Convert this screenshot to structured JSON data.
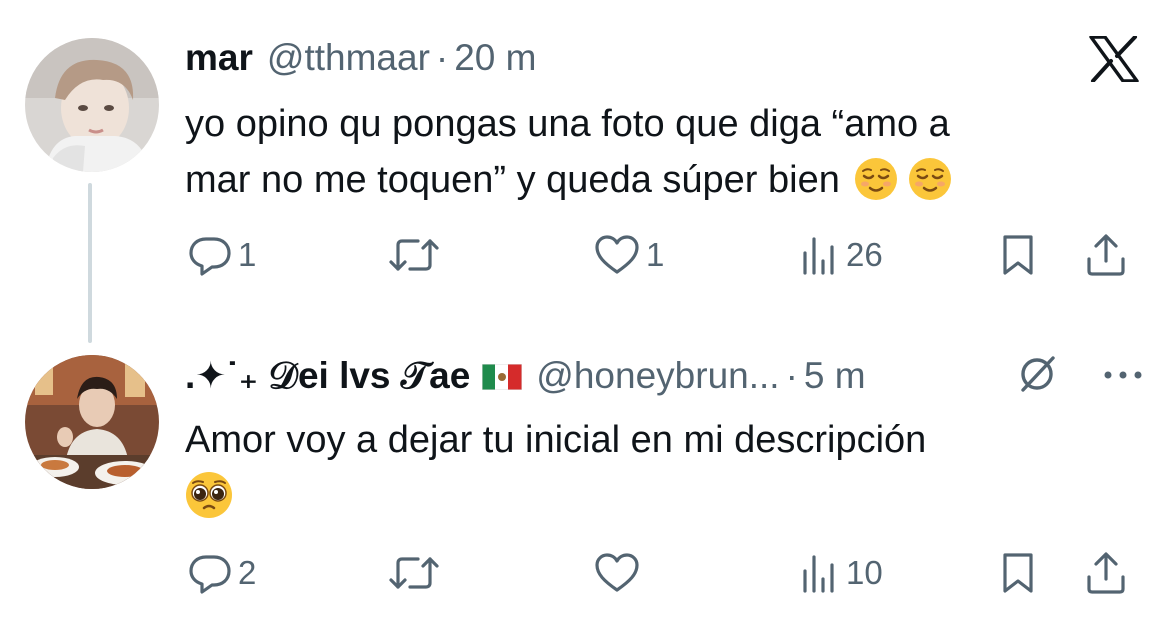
{
  "tweets": [
    {
      "display_name": "mar",
      "handle": "@tthmaar",
      "separator": "·",
      "time": "20 m",
      "text": "yo opino qu pongas una foto que diga “amo a",
      "text_line2": "mar no me toquen” y queda súper bien",
      "emojis": [
        "relieved-face-emoji",
        "relieved-face-emoji"
      ],
      "reply_count": "1",
      "retweet_count": "",
      "like_count": "1",
      "view_count": "26"
    },
    {
      "display_name": ".✦˙₊ 𝒟ei lvs 𝒯ae",
      "flag": "mexico-flag",
      "handle": "@honeybrun...",
      "separator": "·",
      "time": "5 m",
      "text": "Amor voy a dejar tu inicial en mi descripción",
      "emojis": [
        "pleading-face-emoji"
      ],
      "reply_count": "2",
      "retweet_count": "",
      "like_count": "",
      "view_count": "10"
    }
  ],
  "icons": [
    "x-logo-icon",
    "grok-slash-icon",
    "more-icon",
    "reply-icon",
    "retweet-icon",
    "like-icon",
    "views-icon",
    "bookmark-icon",
    "share-icon"
  ],
  "colors": {
    "text": "#0f1419",
    "secondary": "#536471",
    "thread_line": "#cfd9de"
  }
}
